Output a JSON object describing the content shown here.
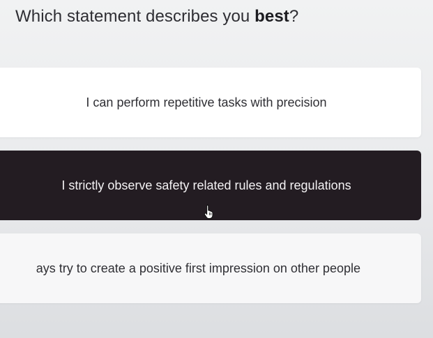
{
  "question": {
    "prefix": "Which statement describes you ",
    "emphasis": "best",
    "suffix": "?"
  },
  "options": [
    {
      "text": "I can perform repetitive tasks with precision",
      "selected": false
    },
    {
      "text": "I strictly observe safety related rules and regulations",
      "selected": true
    },
    {
      "text": "ays try to create a positive first impression on other people",
      "selected": false
    }
  ],
  "colors": {
    "selected_bg": "#231c22",
    "card_bg": "#ffffff",
    "text": "#2f2f34"
  },
  "cursor": {
    "icon": "hand-pointer-icon"
  }
}
